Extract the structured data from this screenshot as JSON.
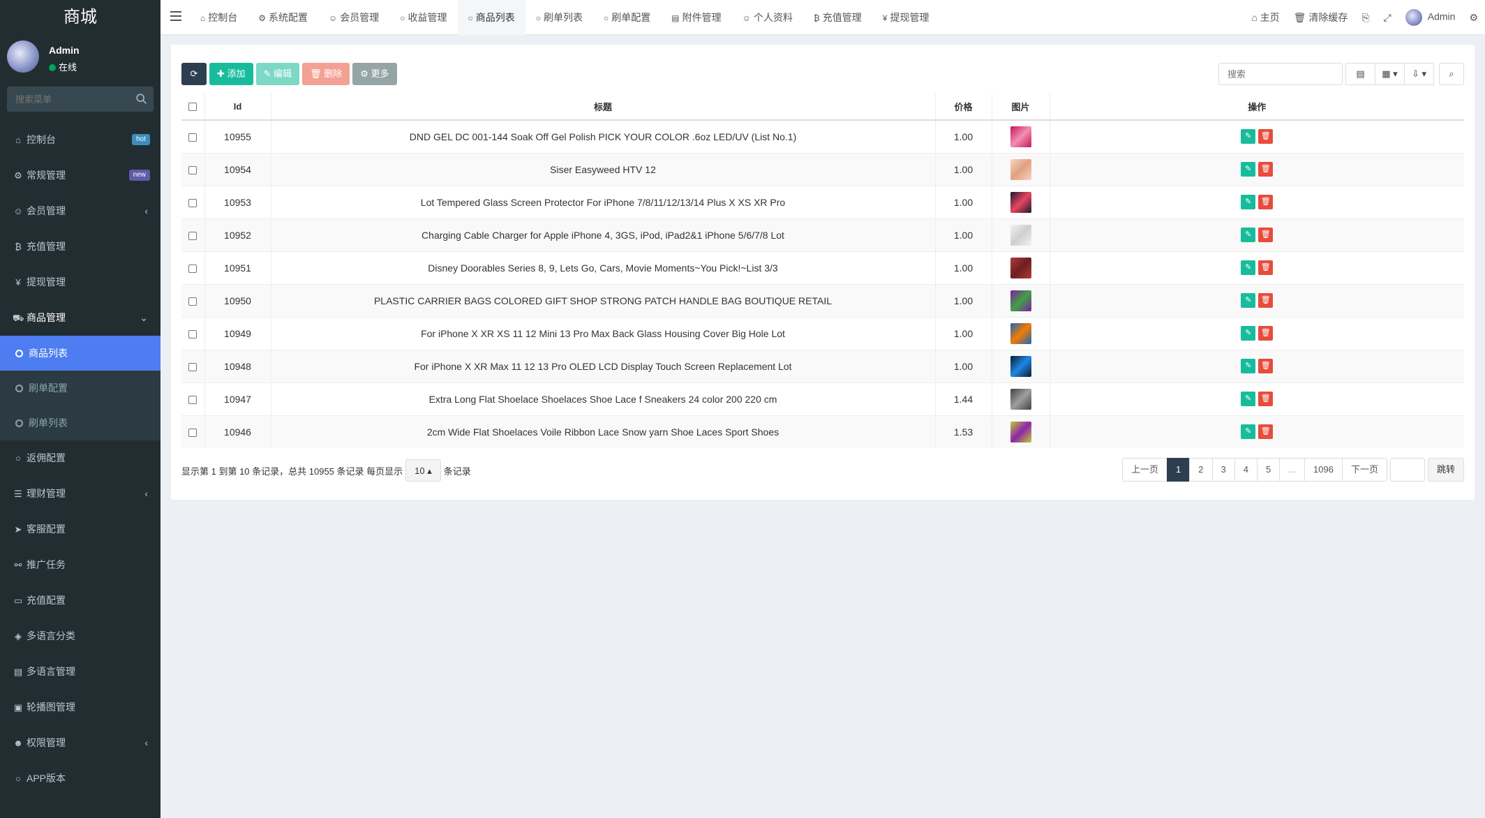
{
  "sidebar": {
    "brand": "商城",
    "user": {
      "name": "Admin",
      "status": "在线"
    },
    "search_placeholder": "搜索菜单",
    "items": [
      {
        "label": "控制台",
        "icon": "dashboard-icon",
        "glyph": "⌂",
        "badge": "hot"
      },
      {
        "label": "常规管理",
        "icon": "cogs-icon",
        "glyph": "⚙",
        "badge": "new"
      },
      {
        "label": "会员管理",
        "icon": "user-icon",
        "glyph": "☺",
        "caret": "‹"
      },
      {
        "label": "充值管理",
        "icon": "bitcoin-icon",
        "glyph": "₿"
      },
      {
        "label": "提现管理",
        "icon": "yen-icon",
        "glyph": "¥"
      },
      {
        "label": "商品管理",
        "icon": "cart-icon",
        "glyph": "⛟",
        "caret": "⌄"
      }
    ],
    "submenu": [
      {
        "label": "商品列表"
      },
      {
        "label": "刷单配置"
      },
      {
        "label": "刷单列表"
      }
    ],
    "items_after": [
      {
        "label": "返佣配置",
        "icon": "circle-icon",
        "glyph": "○"
      },
      {
        "label": "理财管理",
        "icon": "list-icon",
        "glyph": "☰",
        "caret": "‹"
      },
      {
        "label": "客服配置",
        "icon": "telegram-icon",
        "glyph": "➤"
      },
      {
        "label": "推广任务",
        "icon": "link-icon",
        "glyph": "⚯"
      },
      {
        "label": "充值配置",
        "icon": "card-icon",
        "glyph": "▭"
      },
      {
        "label": "多语言分类",
        "icon": "tag-icon",
        "glyph": "◈"
      },
      {
        "label": "多语言管理",
        "icon": "language-icon",
        "glyph": "▤"
      },
      {
        "label": "轮播图管理",
        "icon": "image-icon",
        "glyph": "▣"
      },
      {
        "label": "权限管理",
        "icon": "group-icon",
        "glyph": "☻",
        "caret": "‹"
      },
      {
        "label": "APP版本",
        "icon": "circle-icon",
        "glyph": "○"
      }
    ]
  },
  "topbar": {
    "tabs": [
      {
        "label": "控制台",
        "glyph": "⌂"
      },
      {
        "label": "系统配置",
        "glyph": "⚙"
      },
      {
        "label": "会员管理",
        "glyph": "☺"
      },
      {
        "label": "收益管理",
        "glyph": "○"
      },
      {
        "label": "商品列表",
        "glyph": "○"
      },
      {
        "label": "刷单列表",
        "glyph": "○"
      },
      {
        "label": "刷单配置",
        "glyph": "○"
      },
      {
        "label": "附件管理",
        "glyph": "▤"
      },
      {
        "label": "个人资料",
        "glyph": "☺"
      },
      {
        "label": "充值管理",
        "glyph": "₿"
      },
      {
        "label": "提现管理",
        "glyph": "¥"
      }
    ],
    "home": "主页",
    "clear_cache": "清除缓存",
    "admin": "Admin"
  },
  "toolbar": {
    "add": "添加",
    "edit": "编辑",
    "delete": "删除",
    "more": "更多",
    "search_placeholder": "搜索"
  },
  "table": {
    "headers": {
      "id": "Id",
      "title": "标题",
      "price": "价格",
      "image": "图片",
      "actions": "操作"
    },
    "rows": [
      {
        "id": "10955",
        "title": "DND GEL DC 001-144 Soak Off Gel Polish PICK YOUR COLOR .6oz LED/UV (List No.1)",
        "price": "1.00",
        "thumb": [
          "#c2185b",
          "#f48fb1"
        ]
      },
      {
        "id": "10954",
        "title": "Siser Easyweed HTV 12",
        "price": "1.00",
        "thumb": [
          "#f5d5c5",
          "#e0a080"
        ]
      },
      {
        "id": "10953",
        "title": "Lot Tempered Glass Screen Protector For iPhone 7/8/11/12/13/14 Plus X XS XR Pro",
        "price": "1.00",
        "thumb": [
          "#1a1a2e",
          "#e94560"
        ]
      },
      {
        "id": "10952",
        "title": "Charging Cable Charger for Apple iPhone 4, 3GS, iPod, iPad2&1 iPhone 5/6/7/8 Lot",
        "price": "1.00",
        "thumb": [
          "#f2f2f2",
          "#cfcfcf"
        ]
      },
      {
        "id": "10951",
        "title": "Disney Doorables Series 8, 9, Lets Go, Cars, Movie Moments~You Pick!~List 3/3",
        "price": "1.00",
        "thumb": [
          "#b23a3a",
          "#6d1f1f"
        ]
      },
      {
        "id": "10950",
        "title": "PLASTIC CARRIER BAGS COLORED GIFT SHOP STRONG PATCH HANDLE BAG BOUTIQUE RETAIL",
        "price": "1.00",
        "thumb": [
          "#7b1fa2",
          "#43a047"
        ]
      },
      {
        "id": "10949",
        "title": "For iPhone X XR XS 11 12 Mini 13 Pro Max Back Glass Housing Cover Big Hole Lot",
        "price": "1.00",
        "thumb": [
          "#1565c0",
          "#f57c00"
        ]
      },
      {
        "id": "10948",
        "title": "For iPhone X XR Max 11 12 13 Pro OLED LCD Display Touch Screen Replacement Lot",
        "price": "1.00",
        "thumb": [
          "#0d1b2a",
          "#1e88e5"
        ]
      },
      {
        "id": "10947",
        "title": "Extra Long Flat Shoelace Shoelaces Shoe Lace f Sneakers 24 color 200 220 cm",
        "price": "1.44",
        "thumb": [
          "#424242",
          "#9e9e9e"
        ]
      },
      {
        "id": "10946",
        "title": "2cm Wide Flat Shoelaces Voile Ribbon Lace Snow yarn Shoe Laces Sport Shoes",
        "price": "1.53",
        "thumb": [
          "#c0ca33",
          "#8e24aa"
        ]
      }
    ]
  },
  "footer": {
    "info": "显示第 1 到第 10 条记录，总共 10955 条记录 每页显示",
    "page_size": "10",
    "info_suffix": "条记录",
    "prev": "上一页",
    "pages": [
      "1",
      "2",
      "3",
      "4",
      "5",
      "...",
      "1096"
    ],
    "next": "下一页",
    "jump": "跳转"
  },
  "colors": {
    "sidebar_bg": "#222d32",
    "active": "#4d7df0",
    "primary": "#18bc9c",
    "danger": "#e74c3c",
    "dark": "#2c3e50"
  }
}
